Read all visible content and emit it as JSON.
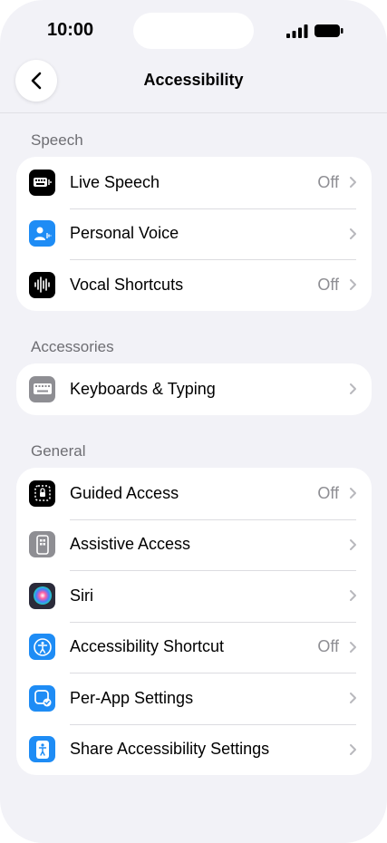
{
  "status_bar": {
    "time": "10:00"
  },
  "nav": {
    "title": "Accessibility"
  },
  "sections": [
    {
      "header": "Speech",
      "items": [
        {
          "label": "Live Speech",
          "value": "Off",
          "icon": "keyboard-wave-icon",
          "color": "#000000"
        },
        {
          "label": "Personal Voice",
          "value": "",
          "icon": "person-wave-icon",
          "color": "#1e8cf5"
        },
        {
          "label": "Vocal Shortcuts",
          "value": "Off",
          "icon": "waveform-icon",
          "color": "#000000"
        }
      ]
    },
    {
      "header": "Accessories",
      "items": [
        {
          "label": "Keyboards & Typing",
          "value": "",
          "icon": "keyboard-icon",
          "color": "#8e8e93"
        }
      ]
    },
    {
      "header": "General",
      "items": [
        {
          "label": "Guided Access",
          "value": "Off",
          "icon": "lock-dashed-icon",
          "color": "#000000"
        },
        {
          "label": "Assistive Access",
          "value": "",
          "icon": "phone-grid-icon",
          "color": "#8e8e93"
        },
        {
          "label": "Siri",
          "value": "",
          "icon": "siri-icon",
          "color": "#2b2b3a"
        },
        {
          "label": "Accessibility Shortcut",
          "value": "Off",
          "icon": "accessibility-icon",
          "color": "#1e8cf5"
        },
        {
          "label": "Per-App Settings",
          "value": "",
          "icon": "app-check-icon",
          "color": "#1e8cf5"
        },
        {
          "label": "Share Accessibility Settings",
          "value": "",
          "icon": "share-person-icon",
          "color": "#1e8cf5"
        }
      ]
    }
  ]
}
